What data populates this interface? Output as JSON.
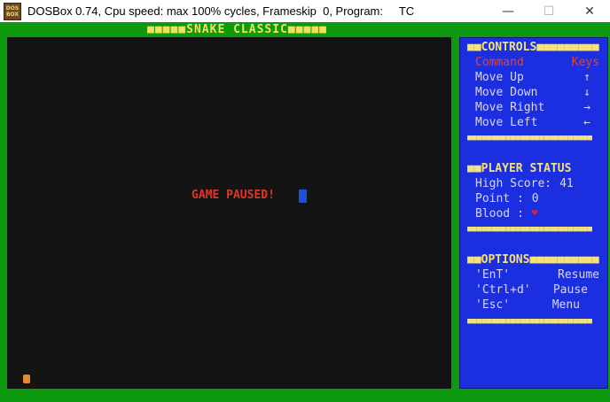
{
  "window": {
    "title": "DOSBox 0.74, Cpu speed: max 100% cycles, Frameskip  0, Program:     TC",
    "icon_label_top": "DOS",
    "icon_label_bottom": "BOX",
    "minimize_glyph": "—",
    "maximize_glyph": "☐",
    "close_glyph": "✕"
  },
  "game": {
    "header": "■■■■■SNAKE CLASSIC■■■■■",
    "paused_text": "GAME PAUSED!"
  },
  "sidebar": {
    "controls": {
      "title": "■■CONTROLS■■■■■■■■■",
      "header_command": "Command",
      "header_keys": "Keys",
      "items": [
        {
          "label": "Move Up",
          "key": "↑"
        },
        {
          "label": "Move Down",
          "key": "↓"
        },
        {
          "label": "Move Right",
          "key": "→"
        },
        {
          "label": "Move Left",
          "key": "←"
        }
      ]
    },
    "status": {
      "title": "■■PLAYER STATUS",
      "high_score_label": "High Score:",
      "high_score": "41",
      "point_label": "Point :",
      "point": "0",
      "blood_label": "Blood :",
      "blood_icon": "♥"
    },
    "options": {
      "title": "■■OPTIONS■■■■■■■■■■",
      "items": [
        {
          "key": "'EnT'",
          "action": "Resume"
        },
        {
          "key": "'Ctrl+d'",
          "action": "Pause"
        },
        {
          "key": "'Esc'",
          "action": "Menu"
        }
      ]
    },
    "divider": "■■■■■■■■■■■■■■■■■■■■■■■■■■"
  },
  "colors": {
    "frame_green": "#0e9a0e",
    "panel_blue": "#1b2ee0",
    "accent_yellow": "#f4e27a",
    "paused_red": "#d83a2a"
  }
}
